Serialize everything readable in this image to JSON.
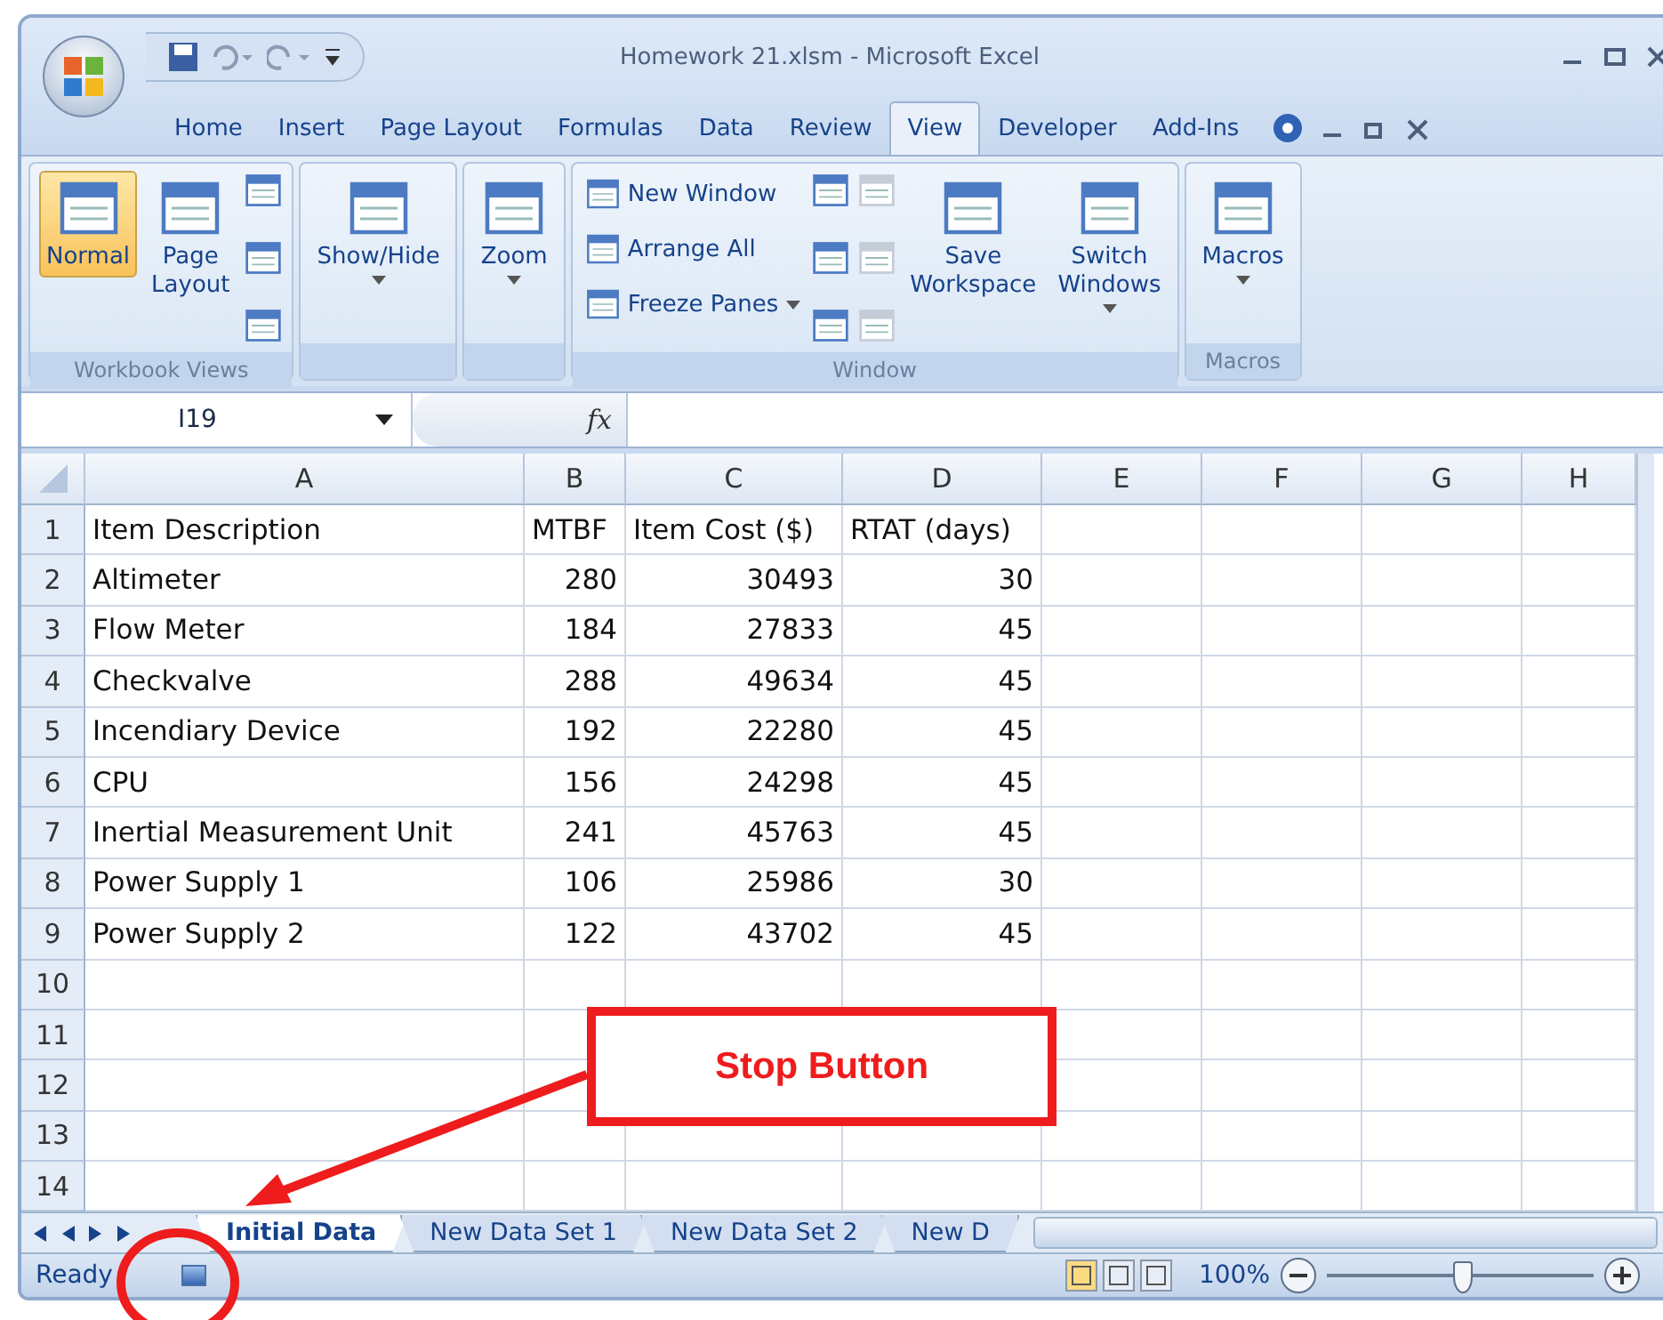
{
  "window": {
    "title": "Homework 21.xlsm - Microsoft Excel"
  },
  "ribbon_tabs": [
    {
      "label": "Home",
      "selected": false
    },
    {
      "label": "Insert",
      "selected": false
    },
    {
      "label": "Page Layout",
      "selected": false
    },
    {
      "label": "Formulas",
      "selected": false
    },
    {
      "label": "Data",
      "selected": false
    },
    {
      "label": "Review",
      "selected": false
    },
    {
      "label": "View",
      "selected": true
    },
    {
      "label": "Developer",
      "selected": false
    },
    {
      "label": "Add-Ins",
      "selected": false
    }
  ],
  "ribbon_groups": [
    {
      "label": "Workbook Views",
      "buttons": [
        {
          "kind": "large",
          "label": "Normal",
          "selected": true
        },
        {
          "kind": "large",
          "label": "Page Layout",
          "selected": false
        },
        {
          "kind": "iconstack"
        }
      ]
    },
    {
      "buttons": [
        {
          "kind": "large",
          "label": "Show/Hide",
          "dropdown": true,
          "selected": false
        }
      ]
    },
    {
      "buttons": [
        {
          "kind": "large",
          "label": "Zoom",
          "dropdown": true,
          "selected": false
        }
      ]
    },
    {
      "label": "Window",
      "buttons": [
        {
          "kind": "smallstack",
          "items": [
            {
              "label": "New Window",
              "dropdown": false
            },
            {
              "label": "Arrange All",
              "dropdown": false
            },
            {
              "label": "Freeze Panes",
              "dropdown": true
            }
          ]
        },
        {
          "kind": "iconstack",
          "disabled": false
        },
        {
          "kind": "iconstack",
          "disabled": true
        },
        {
          "kind": "large",
          "label": "Save Workspace",
          "selected": false
        },
        {
          "kind": "large",
          "label": "Switch Windows",
          "dropdown": true,
          "selected": false
        }
      ]
    },
    {
      "label": "Macros",
      "buttons": [
        {
          "kind": "large",
          "label": "Macros",
          "dropdown": true,
          "selected": false
        }
      ]
    }
  ],
  "formula_bar": {
    "name_box": "I19",
    "function_label": "fx"
  },
  "sheet": {
    "columns": [
      "A",
      "B",
      "C",
      "D",
      "E",
      "F",
      "G",
      "H"
    ],
    "rows": [
      {
        "header": "1",
        "cells": [
          "Item Description",
          "MTBF",
          "Item Cost ($)",
          "RTAT (days)"
        ],
        "kind": "header"
      },
      {
        "header": "2",
        "cells": [
          "Altimeter",
          "280",
          "30493",
          "30"
        ]
      },
      {
        "header": "3",
        "cells": [
          "Flow Meter",
          "184",
          "27833",
          "45"
        ]
      },
      {
        "header": "4",
        "cells": [
          "Checkvalve",
          "288",
          "49634",
          "45"
        ]
      },
      {
        "header": "5",
        "cells": [
          "Incendiary Device",
          "192",
          "22280",
          "45"
        ]
      },
      {
        "header": "6",
        "cells": [
          "CPU",
          "156",
          "24298",
          "45"
        ]
      },
      {
        "header": "7",
        "cells": [
          "Inertial Measurement Unit",
          "241",
          "45763",
          "45"
        ]
      },
      {
        "header": "8",
        "cells": [
          "Power Supply 1",
          "106",
          "25986",
          "30"
        ]
      },
      {
        "header": "9",
        "cells": [
          "Power Supply 2",
          "122",
          "43702",
          "45"
        ]
      },
      {
        "header": "10",
        "cells": []
      },
      {
        "header": "11",
        "cells": []
      },
      {
        "header": "12",
        "cells": []
      },
      {
        "header": "13",
        "cells": []
      },
      {
        "header": "14",
        "cells": []
      }
    ]
  },
  "sheet_tabs": [
    {
      "label": "Initial Data",
      "selected": true
    },
    {
      "label": "New Data Set 1",
      "selected": false
    },
    {
      "label": "New Data Set 2",
      "selected": false
    },
    {
      "label": "New D",
      "selected": false
    }
  ],
  "status_bar": {
    "text": "Ready",
    "view_buttons": [
      {
        "selected": true
      },
      {
        "selected": false
      },
      {
        "selected": false
      }
    ],
    "zoom": "100%",
    "zoom_slider": {
      "level": 0.5
    }
  },
  "annotation": {
    "label": "Stop Button"
  }
}
